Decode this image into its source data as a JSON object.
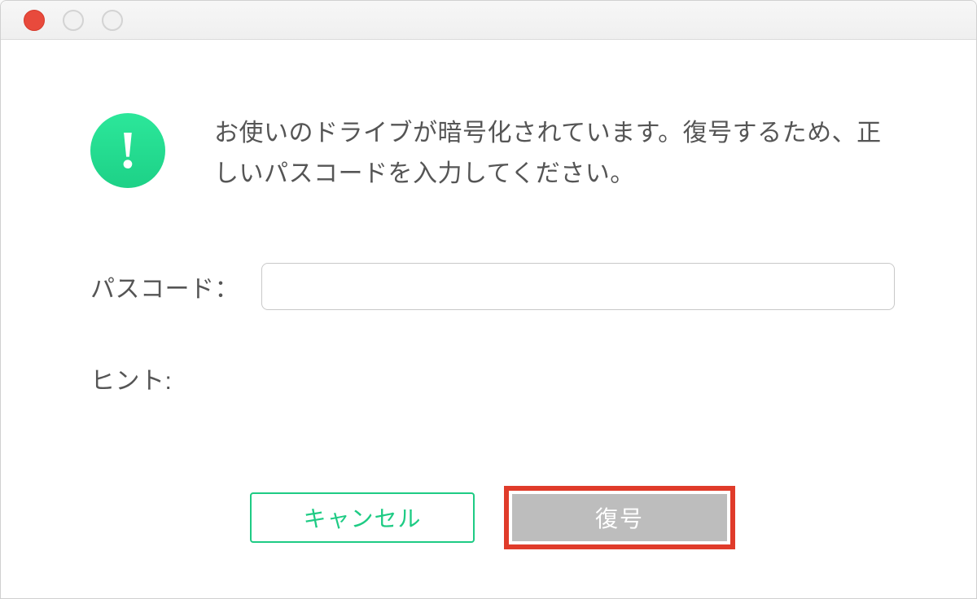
{
  "dialog": {
    "message": "お使いのドライブが暗号化されています。復号するため、正しいパスコードを入力してください。",
    "passcode_label": "パスコード：",
    "passcode_value": "",
    "hint_label": "ヒント:",
    "hint_value": "",
    "cancel_label": "キャンセル",
    "decrypt_label": "復号"
  },
  "icons": {
    "alert": "!"
  },
  "colors": {
    "accent_green": "#1ecb84",
    "highlight_red": "#e03b2a",
    "disabled_gray": "#bdbdbd"
  }
}
